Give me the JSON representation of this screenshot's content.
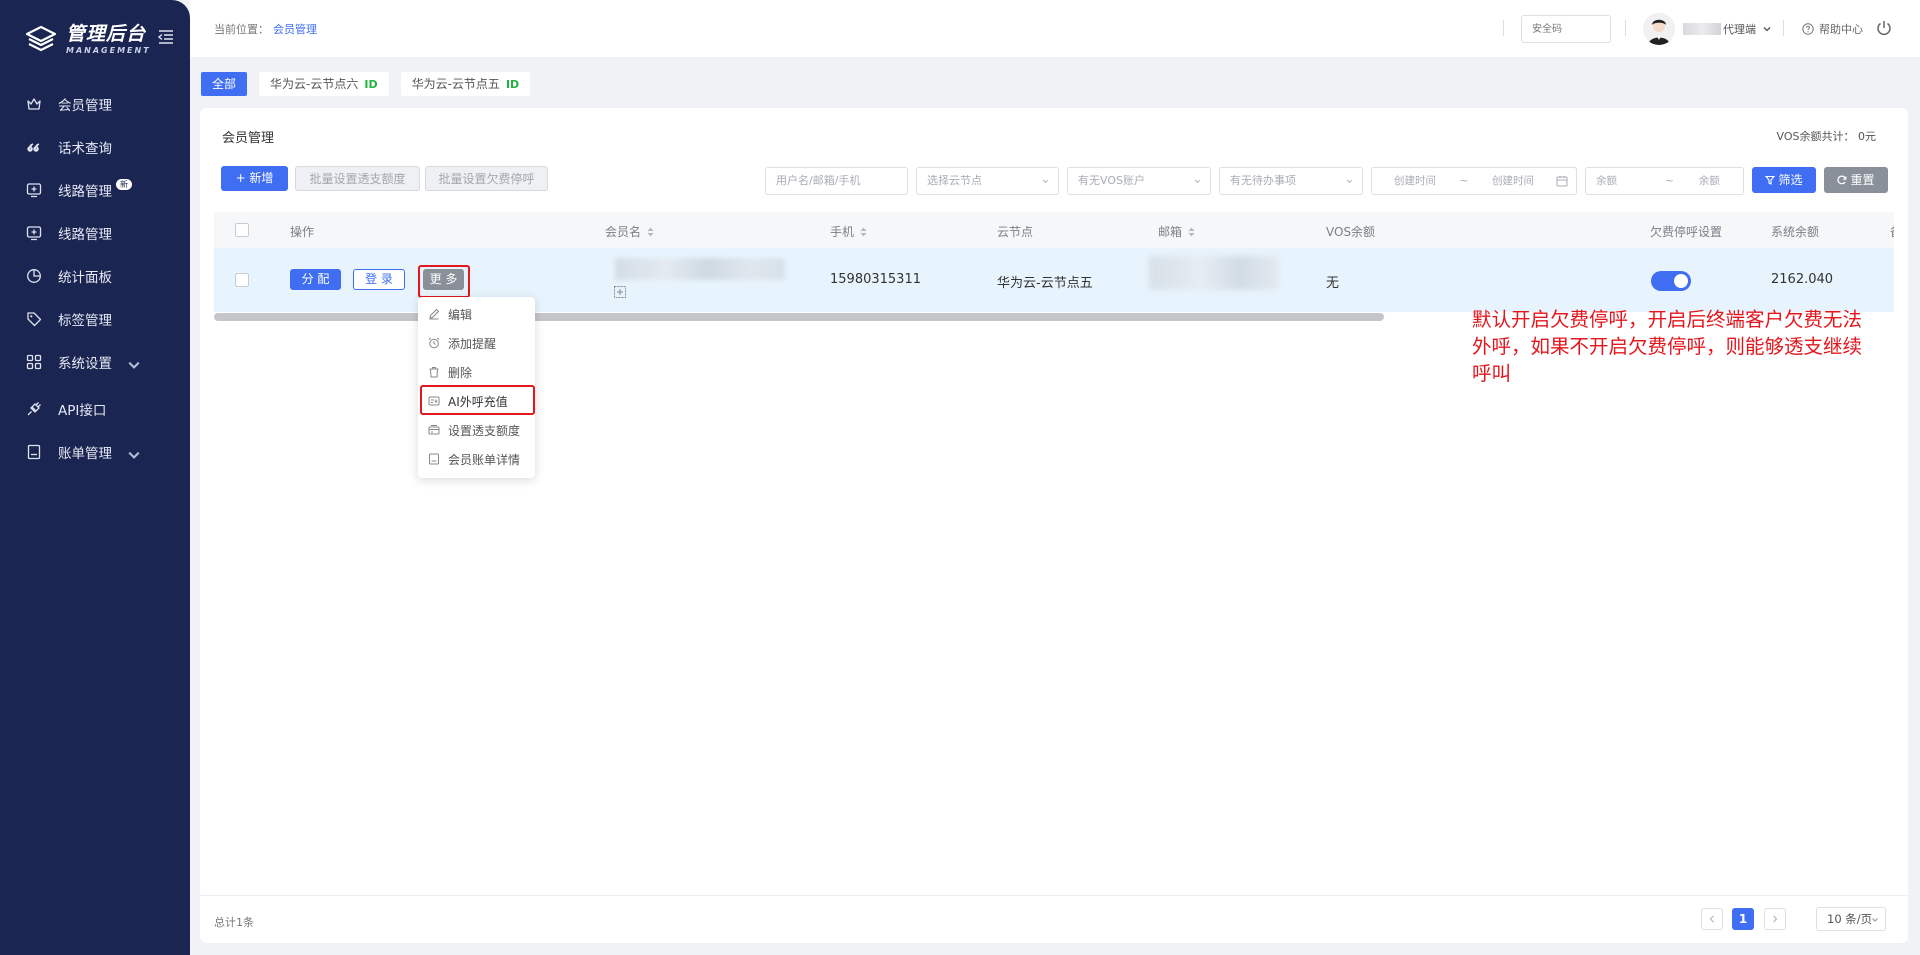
{
  "sidebar": {
    "logo_title": "管理后台",
    "logo_sub": "MANAGEMENT",
    "items": [
      {
        "label": "会员管理",
        "icon": "crown-icon"
      },
      {
        "label": "话术查询",
        "icon": "quote-icon"
      },
      {
        "label": "线路管理",
        "icon": "monitor-plus-icon",
        "badge": "新"
      },
      {
        "label": "线路管理",
        "icon": "monitor-plus-icon"
      },
      {
        "label": "统计面板",
        "icon": "pie-chart-icon"
      },
      {
        "label": "标签管理",
        "icon": "tag-icon"
      },
      {
        "label": "系统设置",
        "icon": "grid-icon"
      },
      {
        "label": "API接口",
        "icon": "plug-icon"
      },
      {
        "label": "账单管理",
        "icon": "bill-icon"
      }
    ]
  },
  "header": {
    "breadcrumb_prefix": "当前位置：",
    "breadcrumb_current": "会员管理",
    "safe_code_placeholder": "安全码",
    "user_name_suffix": "代理端",
    "help_label": "帮助中心"
  },
  "filter_tabs": [
    {
      "label": "全部",
      "active": true
    },
    {
      "label": "华为云-云节点六",
      "tag": "ID"
    },
    {
      "label": "华为云-云节点五",
      "tag": "ID"
    }
  ],
  "card": {
    "title": "会员管理",
    "vos_total": "VOS余额共计：  0元",
    "toolbar": {
      "add_label": "+ 新增",
      "batch_overdraft_label": "批量设置透支额度",
      "batch_stop_label": "批量设置欠费停呼",
      "search_label": "筛选",
      "reset_label": "重置"
    },
    "filters": {
      "user_placeholder": "用户名/邮箱/手机",
      "node_placeholder": "选择云节点",
      "vos_placeholder": "有无VOS账户",
      "todo_placeholder": "有无待办事项",
      "created_start": "创建时间",
      "created_sep": "~",
      "created_end": "创建时间",
      "balance_min": "余额",
      "balance_sep": "~",
      "balance_max": "余额"
    }
  },
  "table": {
    "columns": {
      "action": "操作",
      "member": "会员名",
      "phone": "手机",
      "node": "云节点",
      "email": "邮箱",
      "vos": "VOS余额",
      "stop": "欠费停呼设置",
      "balance": "系统余额",
      "extra": "备"
    },
    "row": {
      "assign": "分 配",
      "login": "登 录",
      "more": "更 多",
      "phone": "15980315311",
      "node": "华为云-云节点五",
      "vos": "无",
      "stop_enabled": true,
      "balance": "2162.040"
    }
  },
  "dropdown": [
    {
      "label": "编辑",
      "icon": "edit-icon"
    },
    {
      "label": "添加提醒",
      "icon": "alarm-icon"
    },
    {
      "label": "删除",
      "icon": "trash-icon"
    },
    {
      "label": "AI外呼充值",
      "icon": "recharge-icon"
    },
    {
      "label": "设置透支额度",
      "icon": "overdraft-icon"
    },
    {
      "label": "会员账单详情",
      "icon": "bill-detail-icon"
    }
  ],
  "annotation": "默认开启欠费停呼，开启后终端客户欠费无法外呼，如果不开启欠费停呼，则能够透支继续呼叫",
  "footer": {
    "total": "总计1条",
    "current_page": "1",
    "page_size": "10 条/页"
  },
  "colors": {
    "sidebar_bg": "#1a2551",
    "primary": "#3f6ef3",
    "annotation_red": "#e4161d",
    "id_green": "#21b33f"
  }
}
